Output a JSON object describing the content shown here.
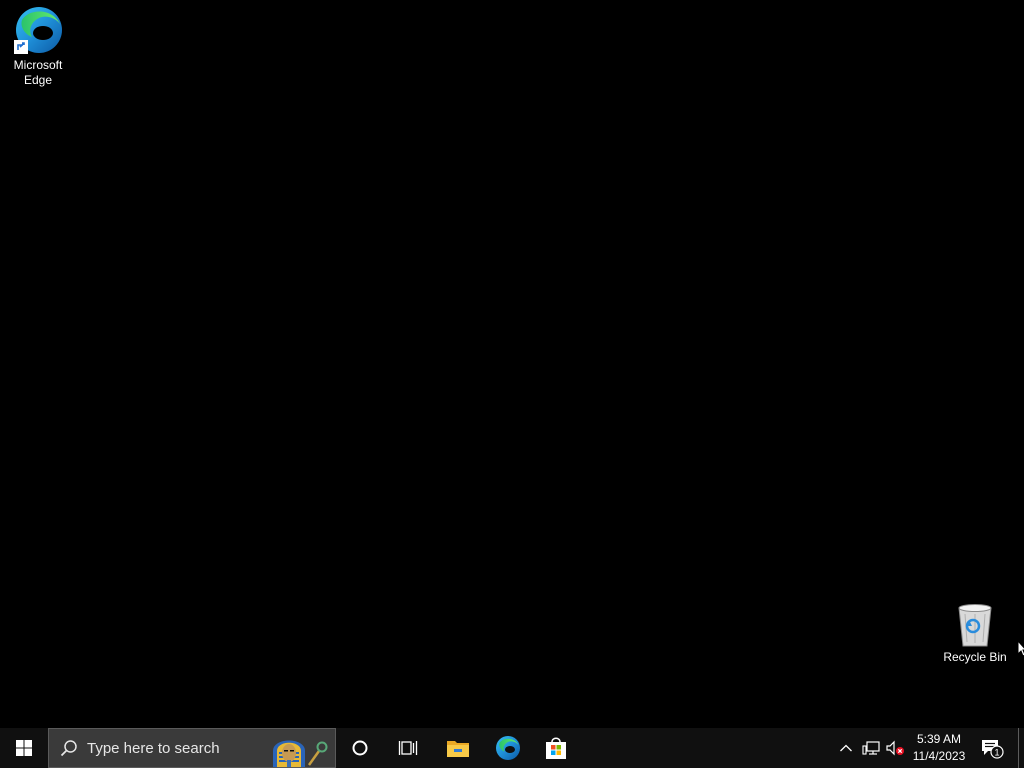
{
  "desktop": {
    "icons": [
      {
        "label_line1": "Microsoft",
        "label_line2": "Edge",
        "icon": "microsoft-edge-icon"
      },
      {
        "label": "Recycle Bin",
        "icon": "recycle-bin-icon"
      }
    ]
  },
  "taskbar": {
    "start_icon": "windows-logo-icon",
    "search": {
      "placeholder": "Type here to search",
      "icon": "search-icon"
    },
    "pinned": [
      {
        "name": "Cortana",
        "icon": "cortana-icon"
      },
      {
        "name": "Task View",
        "icon": "task-view-icon"
      },
      {
        "name": "File Explorer",
        "icon": "file-explorer-icon"
      },
      {
        "name": "Microsoft Edge",
        "icon": "microsoft-edge-icon"
      },
      {
        "name": "Microsoft Store",
        "icon": "microsoft-store-icon"
      }
    ],
    "tray": {
      "icons": [
        "chevron-up-icon",
        "network-icon",
        "volume-muted-icon"
      ],
      "time": "5:39 AM",
      "date": "11/4/2023",
      "notification_count": "1"
    }
  },
  "colors": {
    "desktop_bg": "#000000",
    "taskbar_bg": "#101010",
    "search_bg": "#3a3a3a",
    "accent": "#0078d7"
  }
}
